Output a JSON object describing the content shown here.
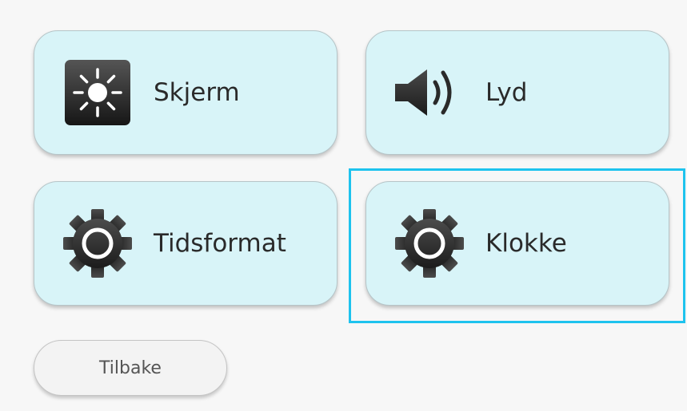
{
  "tiles": {
    "skjerm": {
      "label": "Skjerm",
      "icon": "brightness-icon"
    },
    "lyd": {
      "label": "Lyd",
      "icon": "speaker-icon"
    },
    "tidsformat": {
      "label": "Tidsformat",
      "icon": "gear-icon"
    },
    "klokke": {
      "label": "Klokke",
      "icon": "gear-icon"
    }
  },
  "focused_tile": "klokke",
  "back_button": {
    "label": "Tilbake"
  },
  "colors": {
    "tile_background": "#d8f4f8",
    "focus_ring": "#1ec3ee",
    "page_background": "#f7f7f7",
    "back_button_background": "#f3f3f3"
  }
}
